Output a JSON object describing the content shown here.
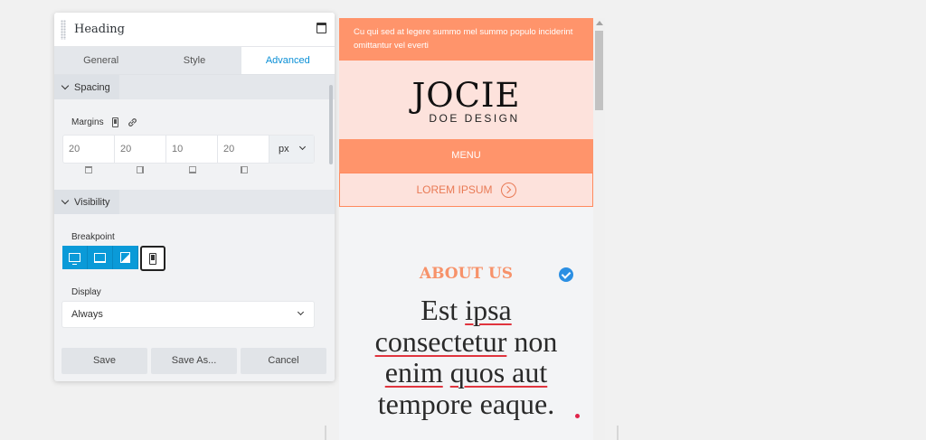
{
  "panel": {
    "title": "Heading",
    "tabs": [
      {
        "label": "General",
        "active": false
      },
      {
        "label": "Style",
        "active": false
      },
      {
        "label": "Advanced",
        "active": true
      }
    ],
    "spacing": {
      "section_label": "Spacing",
      "margins_label": "Margins",
      "values": [
        "20",
        "20",
        "10",
        "20"
      ],
      "unit": "px"
    },
    "visibility": {
      "section_label": "Visibility",
      "breakpoint_label": "Breakpoint",
      "breakpoints": [
        "desktop",
        "laptop",
        "tablet",
        "phone"
      ],
      "selected_breakpoint": "phone",
      "display_label": "Display",
      "display_value": "Always"
    },
    "buttons": {
      "save": "Save",
      "save_as": "Save As...",
      "cancel": "Cancel"
    },
    "accent_color": "#0a9ad8"
  },
  "preview": {
    "topbar_text": "Cu qui sed at legere summo mel summo populo inciderint omittantur vel everti",
    "logo_title": "JOCIE",
    "logo_subtitle": "DOE DESIGN",
    "menu_label": "MENU",
    "cta_label": "LOREM IPSUM",
    "about_heading": "ABOUT US",
    "headline_lines": [
      [
        "Est ",
        "ipsa"
      ],
      [
        "consectetur",
        " non"
      ],
      [
        "enim",
        " ",
        "quos aut"
      ],
      [
        "tempore eaque."
      ]
    ],
    "colors": {
      "accent": "#ff946b",
      "pale": "#fde2dc",
      "heading": "#f7926a",
      "spellcheck": "#e0343e"
    }
  }
}
